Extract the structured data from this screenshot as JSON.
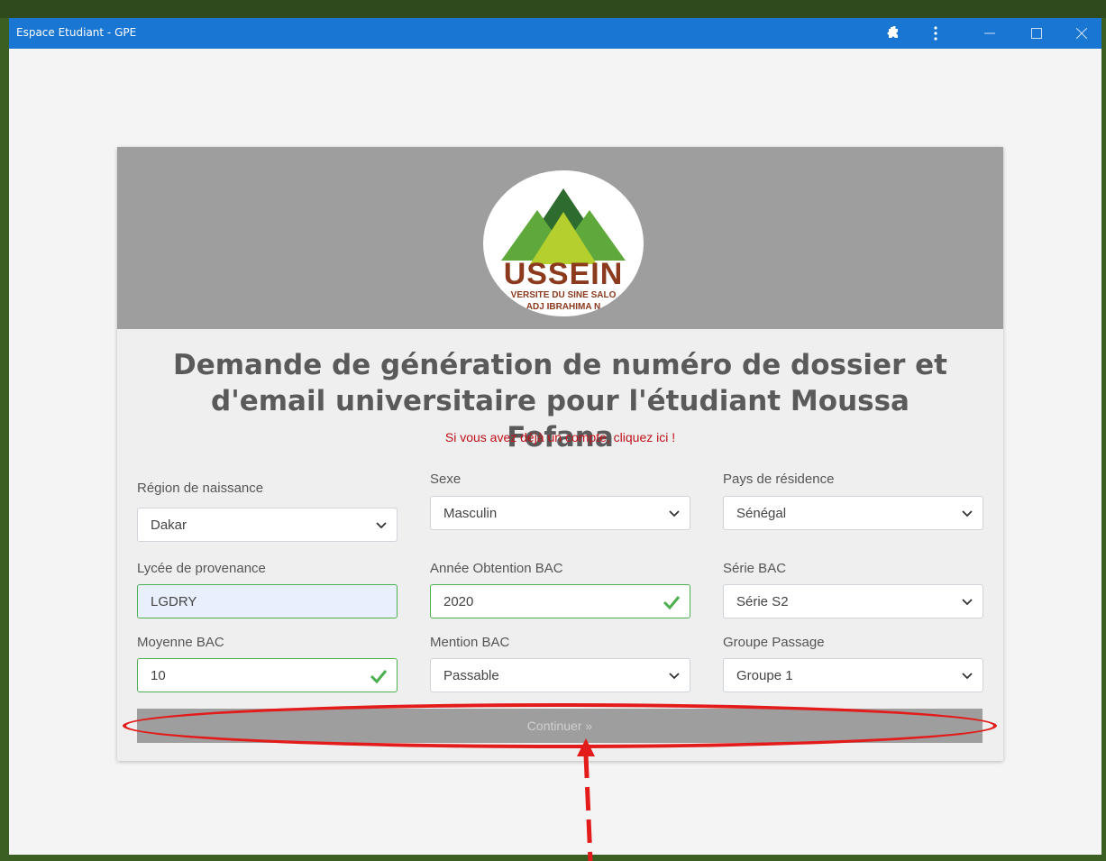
{
  "window": {
    "title": "Espace Etudiant - GPE",
    "icons": [
      "puzzle-icon",
      "more-vert-icon",
      "minimize-icon",
      "maximize-icon",
      "close-icon"
    ]
  },
  "logo": {
    "name": "USSEIN",
    "line1": "VERSITE DU SINE SALO",
    "line2": "ADJ IBRAHIMA N"
  },
  "form": {
    "heading": "Demande de génération de numéro de dossier et d'email universitaire pour l'étudiant Moussa Fofana",
    "login_link": "Si vous avez déjà un compte, cliquez ici !",
    "fields": {
      "region": {
        "label": "Région de naissance",
        "value": "Dakar"
      },
      "sexe": {
        "label": "Sexe",
        "value": "Masculin"
      },
      "pays": {
        "label": "Pays de résidence",
        "value": "Sénégal"
      },
      "lycee": {
        "label": "Lycée de provenance",
        "value": "LGDRY"
      },
      "annee": {
        "label": "Année Obtention BAC",
        "value": "2020"
      },
      "serie": {
        "label": "Série BAC",
        "value": "Série S2"
      },
      "moyenne": {
        "label": "Moyenne BAC",
        "value": "10"
      },
      "mention": {
        "label": "Mention BAC",
        "value": "Passable"
      },
      "groupe": {
        "label": "Groupe Passage",
        "value": "Groupe 1"
      }
    },
    "continue_label": "Continuer »"
  },
  "colors": {
    "titlebar": "#1976d2",
    "accent_red": "#e31b1b",
    "link_red": "#c0111a",
    "valid_green": "#4caf50",
    "header_gray": "#9e9e9e",
    "frame_green": "#3b5e23"
  }
}
